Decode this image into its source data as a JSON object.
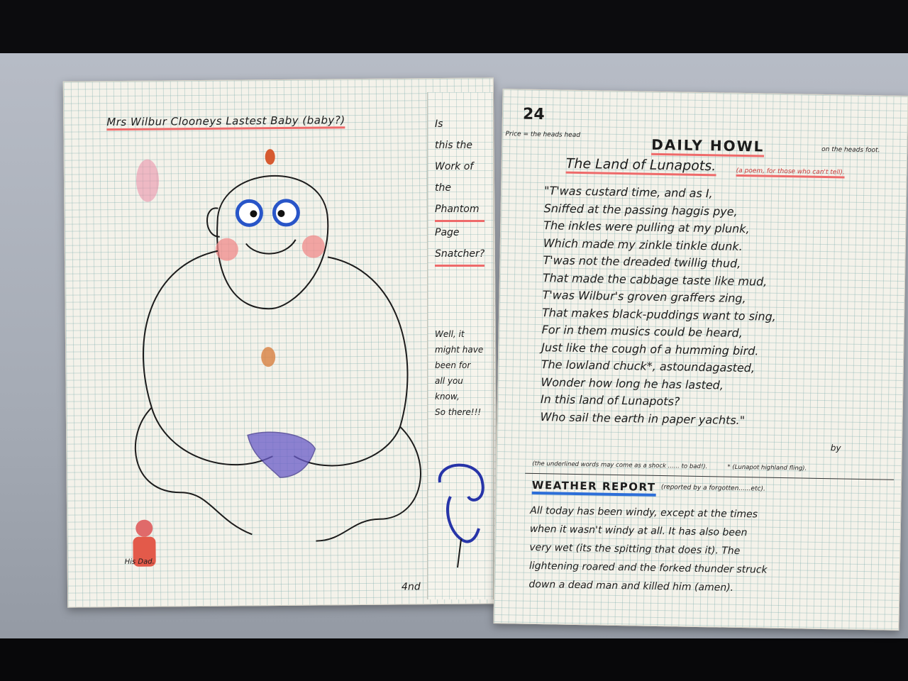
{
  "left_page": {
    "title": "Mrs Wilbur Clooneys Lastest Baby (baby?)",
    "dad_label": "His Dad.",
    "signature": "4nd",
    "strip_lines": [
      "Is",
      "this the",
      "Work of",
      "the",
      "Phantom",
      "Page",
      "Snatcher?"
    ],
    "strip_reply": [
      "Well, it",
      "might have",
      "been for",
      "all you",
      "know,",
      "So there!!!"
    ]
  },
  "right_page": {
    "page_number": "24",
    "price": "Price = the heads head",
    "masthead": "Daily Howl",
    "masthead_note": "on the heads foot.",
    "poem_title": "The Land of Lunapots.",
    "poem_title_note": "(a poem, for those who can't tell).",
    "poem_lines": [
      "\"T'was custard time, and as I,",
      "Sniffed at the passing haggis pye,",
      "The inkles were pulling at my plunk,",
      "Which made my zinkle tinkle dunk.",
      "T'was not the dreaded twillig thud,",
      "That made the cabbage taste like mud,",
      "T'was Wilbur's groven graffers zing,",
      "That makes black-puddings want to sing,",
      "For in them musics could be heard,",
      "Just like the cough of a humming bird.",
      "The lowland chuck*, astoundagasted,",
      "Wonder how long he has lasted,",
      "In this land of Lunapots?",
      "Who sail the earth in paper yachts.\""
    ],
    "byline": "by",
    "footnote_left": "(the underlined words may come as a shock ...... to bad!).",
    "footnote_right": "* (Lunapot highland fling).",
    "weather_title": "Weather Report",
    "weather_note": "(reported by a forgotten......etc).",
    "weather_lines": [
      "All today has been windy, except at the times",
      "when it wasn't windy at all. It has also been",
      "very wet (its the spitting that does it). The",
      "lightening roared and the forked thunder struck",
      "down a dead man and killed him (amen)."
    ]
  },
  "colors": {
    "red": "#ee6a6a",
    "blue": "#2d6ed8",
    "ink": "#1b1b1b"
  }
}
